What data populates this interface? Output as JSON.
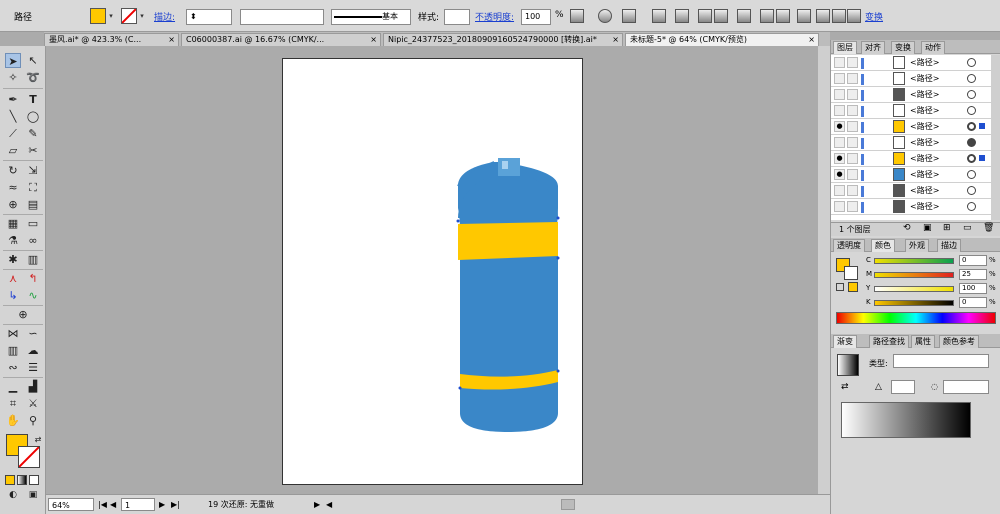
{
  "control_bar": {
    "selection_type": "路径",
    "stroke_label": "描边:",
    "stroke_profile": "基本",
    "style_label": "样式:",
    "opacity_label": "不透明度:",
    "opacity_value": "100",
    "opacity_unit": "%",
    "transform_label": "变换",
    "fill_color": "#ffc800"
  },
  "tabs": [
    {
      "label": "墨风.ai* @ 423.3% (C..."
    },
    {
      "label": "C06000387.ai @ 16.67% (CMYK/..."
    },
    {
      "label": "Nipic_24377523_20180909160524790000 [转换].ai*"
    },
    {
      "label": "未标题-5* @ 64% (CMYK/预览)"
    }
  ],
  "tab_close": "×",
  "status_bar": {
    "zoom": "64%",
    "page": "1",
    "undo_text": "19 次还原: 无重做"
  },
  "layers_panel": {
    "tabs": [
      "图层",
      "对齐",
      "变换",
      "动作"
    ],
    "rows": [
      {
        "name": "<路径>"
      },
      {
        "name": "<路径>"
      },
      {
        "name": "<路径>"
      },
      {
        "name": "<路径>"
      },
      {
        "name": "<路径>"
      },
      {
        "name": "<路径>"
      },
      {
        "name": "<路径>"
      },
      {
        "name": "<路径>"
      },
      {
        "name": "<路径>"
      },
      {
        "name": "<路径>"
      }
    ],
    "footer": "1 个图层"
  },
  "color_panel": {
    "tabs": [
      "透明度",
      "颜色",
      "外观",
      "描边"
    ],
    "channels": [
      {
        "label": "C",
        "value": "0",
        "unit": "%",
        "color": "#0aa050"
      },
      {
        "label": "M",
        "value": "25",
        "unit": "%",
        "color": "#e02020"
      },
      {
        "label": "Y",
        "value": "100",
        "unit": "%",
        "color": "#f0e000"
      },
      {
        "label": "K",
        "value": "0",
        "unit": "%",
        "color": "#000000"
      }
    ]
  },
  "gradient_panel": {
    "tabs": [
      "渐变",
      "路径查找",
      "属性",
      "颜色参考"
    ],
    "type_label": "类型:"
  },
  "artwork": {
    "bottle_color": "#3a87c8",
    "band_color": "#ffc800",
    "cap_color": "#5aa2d8"
  }
}
